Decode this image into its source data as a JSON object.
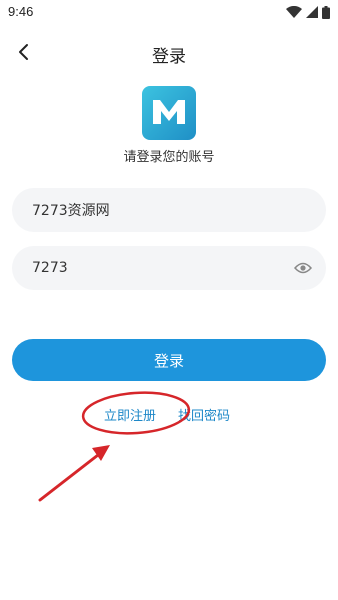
{
  "status_bar": {
    "time": "9:46",
    "icons": [
      "wifi-icon",
      "signal-icon",
      "battery-icon"
    ]
  },
  "nav": {
    "title": "登录",
    "back_icon": "chevron-left-icon"
  },
  "header": {
    "logo_icon": "app-logo-m",
    "subtitle": "请登录您的账号"
  },
  "form": {
    "username_value": "7273资源网",
    "password_value": "7273",
    "password_toggle_icon": "eye-icon",
    "login_label": "登录"
  },
  "links": {
    "register": "立即注册",
    "forgot_password": "找回密码"
  },
  "colors": {
    "accent": "#1e95dc",
    "link": "#1e88c8",
    "input_bg": "#f4f5f7",
    "annotation": "#d6262a"
  }
}
